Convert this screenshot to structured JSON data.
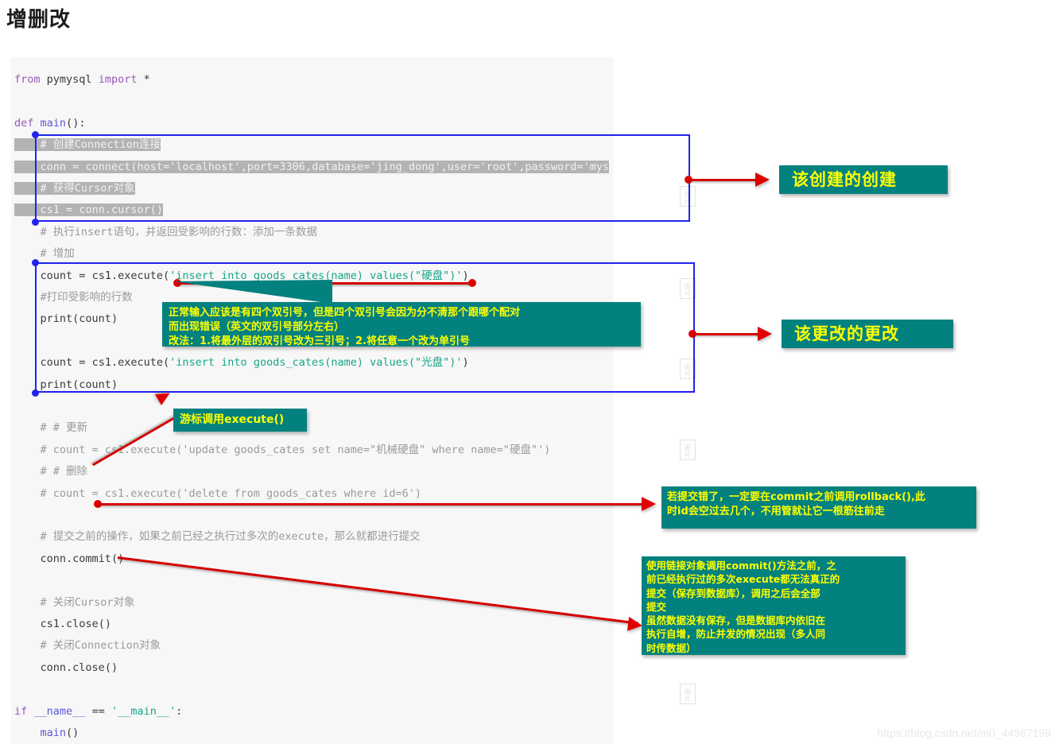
{
  "page": {
    "title": "增删改",
    "watermark": "https://blog.csdn.net/m0_44967199"
  },
  "colors": {
    "code_background": "#f7f7f7",
    "callout_background": "#03817f",
    "callout_text": "#ffff00",
    "arrow": "#e00000",
    "frame": "#2222ee",
    "selection": "#b3b3b3"
  },
  "code": {
    "language": "python",
    "lines": [
      {
        "id": "l1",
        "text": "from pymysql import *",
        "selected": false
      },
      {
        "id": "l2",
        "text": "",
        "selected": false
      },
      {
        "id": "l3",
        "text": "def main():",
        "selected": false
      },
      {
        "id": "l4",
        "text": "    # 创建Connection连接",
        "selected": true
      },
      {
        "id": "l5",
        "text": "    conn = connect(host='localhost',port=3306,database='jing_dong',user='root',password='mys",
        "selected": true
      },
      {
        "id": "l6",
        "text": "    # 获得Cursor对象",
        "selected": true
      },
      {
        "id": "l7",
        "text": "    cs1 = conn.cursor()",
        "selected": true
      },
      {
        "id": "l8",
        "text": "    # 执行insert语句，并返回受影响的行数：添加一条数据",
        "selected": false
      },
      {
        "id": "l9",
        "text": "    # 增加",
        "selected": false
      },
      {
        "id": "l10",
        "text": "    count = cs1.execute('insert into goods_cates(name) values(\"硬盘\")')",
        "selected": false
      },
      {
        "id": "l11",
        "text": "    #打印受影响的行数",
        "selected": false
      },
      {
        "id": "l12",
        "text": "    print(count)",
        "selected": false
      },
      {
        "id": "l13",
        "text": "",
        "selected": false
      },
      {
        "id": "l14",
        "text": "    count = cs1.execute('insert into goods_cates(name) values(\"光盘\")')",
        "selected": false
      },
      {
        "id": "l15",
        "text": "    print(count)",
        "selected": false
      },
      {
        "id": "l16",
        "text": "",
        "selected": false
      },
      {
        "id": "l17",
        "text": "    # # 更新",
        "selected": false
      },
      {
        "id": "l18",
        "text": "    # count = cs1.execute('update goods_cates set name=\"机械硬盘\" where name=\"硬盘\"')",
        "selected": false
      },
      {
        "id": "l19",
        "text": "    # # 删除",
        "selected": false
      },
      {
        "id": "l20",
        "text": "    # count = cs1.execute('delete from goods_cates where id=6')",
        "selected": false
      },
      {
        "id": "l21",
        "text": "",
        "selected": false
      },
      {
        "id": "l22",
        "text": "    # 提交之前的操作，如果之前已经之执行过多次的execute，那么就都进行提交",
        "selected": false
      },
      {
        "id": "l23",
        "text": "    conn.commit()",
        "selected": false
      },
      {
        "id": "l24",
        "text": "",
        "selected": false
      },
      {
        "id": "l25",
        "text": "    # 关闭Cursor对象",
        "selected": false
      },
      {
        "id": "l26",
        "text": "    cs1.close()",
        "selected": false
      },
      {
        "id": "l27",
        "text": "    # 关闭Connection对象",
        "selected": false
      },
      {
        "id": "l28",
        "text": "    conn.close()",
        "selected": false
      },
      {
        "id": "l29",
        "text": "",
        "selected": false
      },
      {
        "id": "l30",
        "text": "if __name__ == '__main__':",
        "selected": false
      },
      {
        "id": "l31",
        "text": "    main()",
        "selected": false
      }
    ]
  },
  "annotations": {
    "callout_create": "该创建的创建",
    "callout_modify": "该更改的更改",
    "callout_quotes": "正常输入应该是有四个双引号，但是四个双引号会因为分不清那个跟哪个配对\n而出现错误（英文的双引号部分左右）\n改法：1.将最外层的双引号改为三引号；2.将任意一个改为单引号",
    "callout_execute": "游标调用execute()",
    "callout_rollback": "若提交错了，一定要在commit之前调用rollback(),此\n时id会空过去几个，不用管就让它一根筋往前走",
    "callout_commit": "使用链接对象调用commit()方法之前，之\n前已经执行过的多次execute都无法真正的\n提交（保存到数据库），调用之后会全部\n提交\n虽然数据没有保存，但是数据库内依旧在\n执行自增，防止并发的情况出现（多人同\n时传数据）"
  },
  "placeholders": {
    "icon_label": "图片"
  }
}
